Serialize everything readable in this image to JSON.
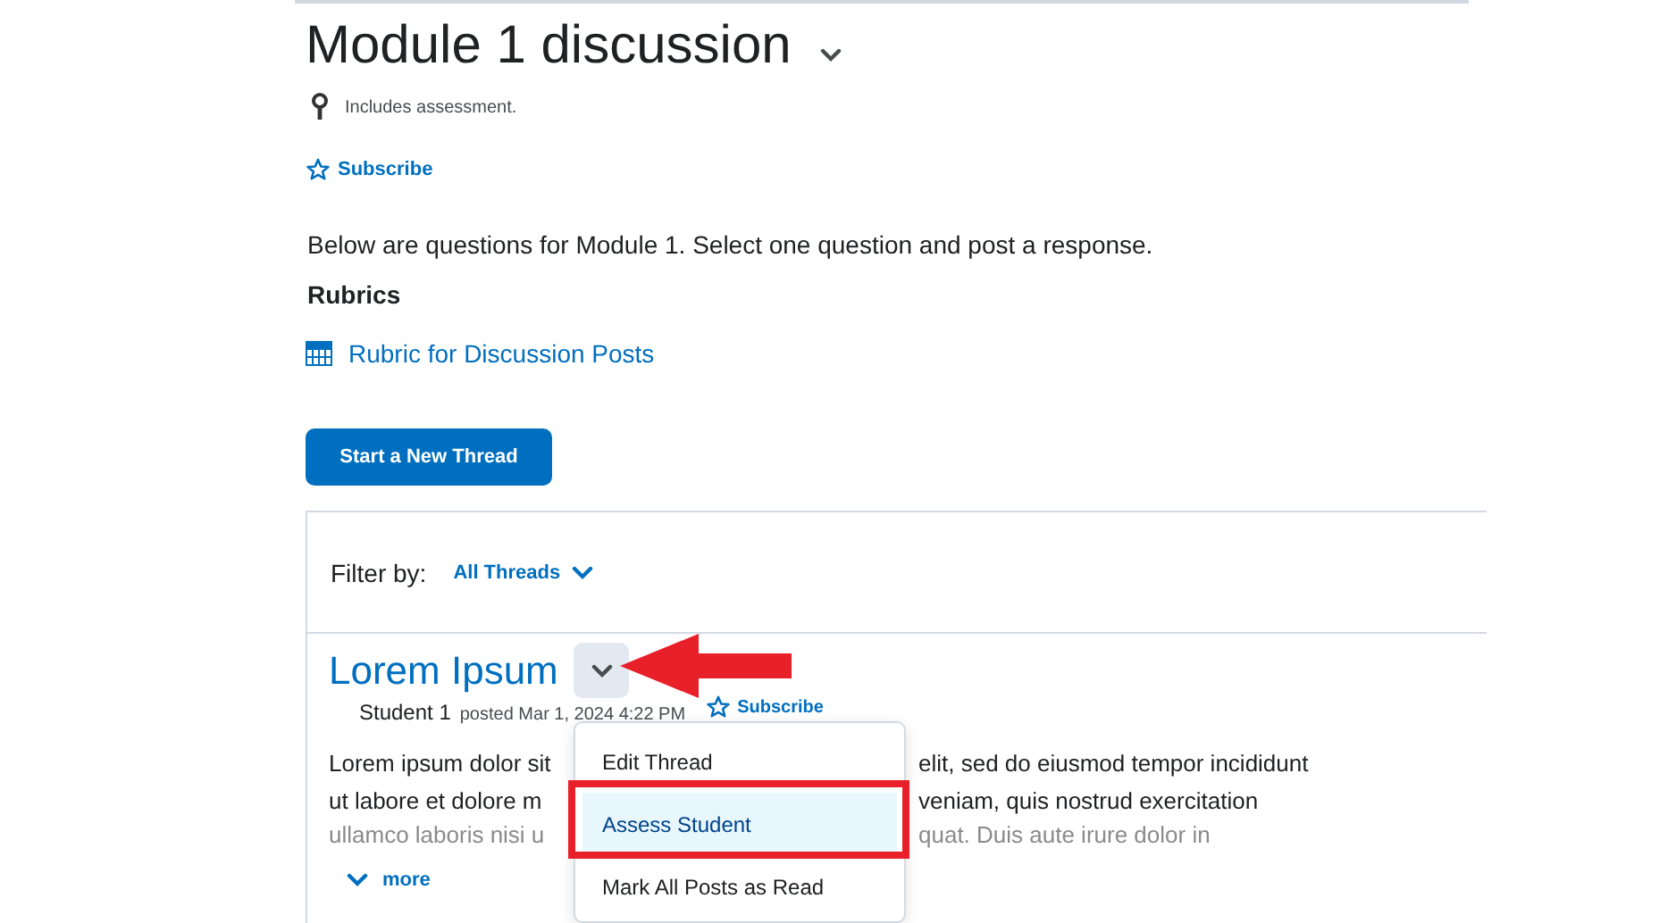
{
  "title": "Module 1 discussion",
  "assessment_note": "Includes assessment.",
  "subscribe": "Subscribe",
  "description": "Below are questions for Module 1. Select one question and post a response.",
  "rubrics": {
    "heading": "Rubrics",
    "items": [
      "Rubric for Discussion Posts"
    ]
  },
  "new_thread_button": "Start a New Thread",
  "filter": {
    "label": "Filter by:",
    "value": "All Threads"
  },
  "thread": {
    "title": "Lorem Ipsum",
    "author": "Student 1",
    "posted": "posted Mar 1, 2024 4:22 PM",
    "subscribe": "Subscribe",
    "body_lines": [
      {
        "left": "Lorem ipsum dolor sit",
        "right": "elit, sed do eiusmod tempor incididunt",
        "faded": false
      },
      {
        "left": "ut labore et dolore m",
        "right": "veniam, quis nostrud exercitation",
        "faded": false
      },
      {
        "left": "ullamco laboris nisi u",
        "right": "quat. Duis aute irure dolor in",
        "faded": true
      }
    ],
    "more": "more"
  },
  "menu": [
    {
      "label": "Edit Thread",
      "selected": false
    },
    {
      "label": "Assess Student",
      "selected": true
    },
    {
      "label": "Mark All Posts as Read",
      "selected": false
    }
  ],
  "annotations": {
    "pointer_arrow": true,
    "highlight_frame": true
  }
}
